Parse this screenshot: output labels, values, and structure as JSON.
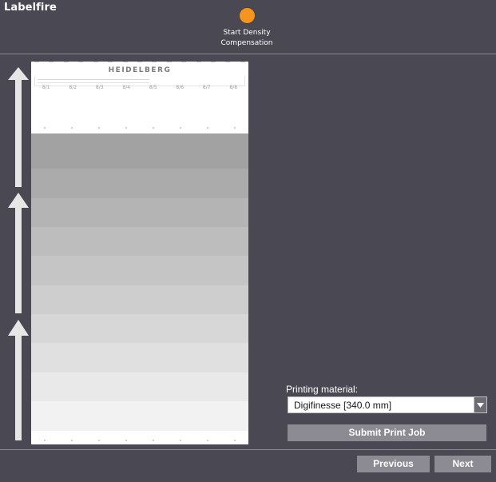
{
  "app": {
    "title": "Labelfire"
  },
  "wizard": {
    "current_step_label": "Start Density\nCompensation",
    "step_color": "#f7941d"
  },
  "preview": {
    "logo_text": "HEIDELBERG",
    "column_labels": [
      "8/1",
      "8/2",
      "8/3",
      "8/4",
      "8/5",
      "8/6",
      "8/7",
      "8/8"
    ],
    "patch_colors": [
      "#a2a2a2",
      "#ababab",
      "#b4b4b4",
      "#bdbdbd",
      "#c5c5c5",
      "#cecece",
      "#d7d7d7",
      "#e0e0e0",
      "#e9e9e9",
      "#f2f2f2"
    ],
    "arrow_icon": "arrow-up-icon"
  },
  "printing_material": {
    "label": "Printing material:",
    "selected": "Digifinesse [340.0 mm]"
  },
  "actions": {
    "submit_label": "Submit Print Job",
    "previous_label": "Previous",
    "next_label": "Next"
  }
}
